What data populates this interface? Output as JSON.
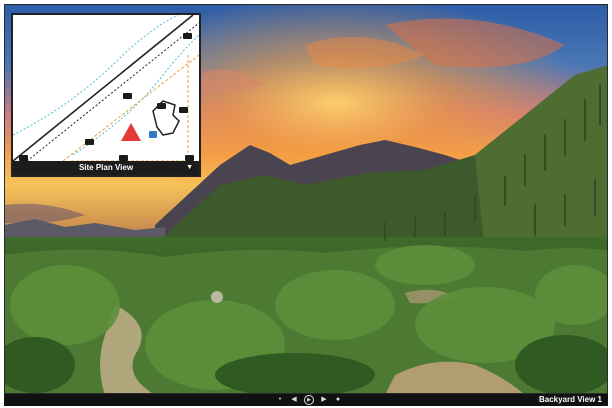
{
  "inset": {
    "title": "Site Plan View",
    "toggle_icon": "caret-down-icon"
  },
  "viewer": {
    "current_view_label": "Backyard View 1"
  },
  "controls": [
    {
      "name": "heading-marker-icon",
      "glyph": "•"
    },
    {
      "name": "previous-view-icon",
      "glyph": "◀"
    },
    {
      "name": "play-icon",
      "glyph": "▶"
    },
    {
      "name": "next-view-icon",
      "glyph": "▶"
    },
    {
      "name": "zoom-icon",
      "glyph": "●"
    }
  ],
  "colors": {
    "toolbar": "#111111",
    "inset_bar": "#1c1c1c",
    "camera_marker": "#1a1a1a",
    "current_position_marker": "#e53935",
    "boundary_line": "#e6a03c",
    "contour_line": "#53bcd6"
  }
}
